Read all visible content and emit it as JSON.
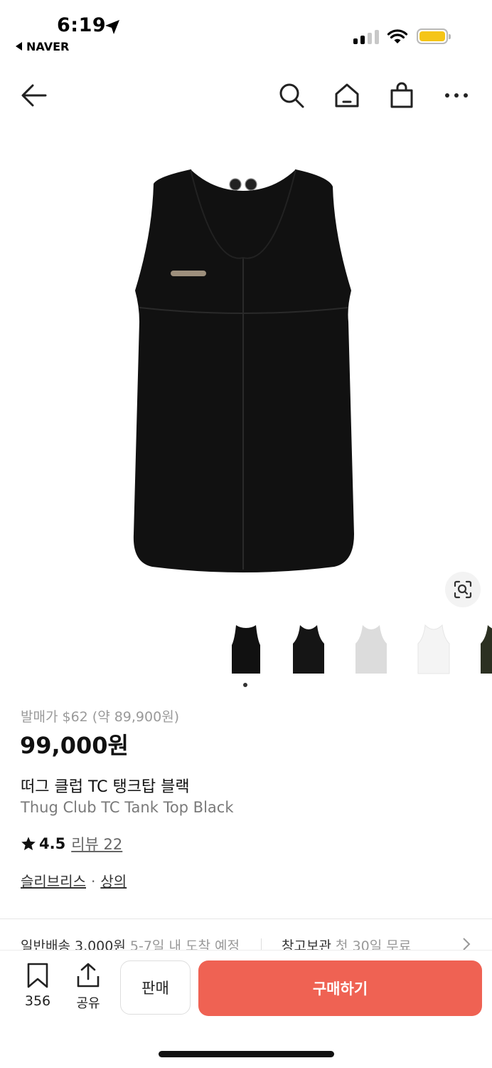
{
  "status_bar": {
    "time": "6:19",
    "back_app": "NAVER"
  },
  "product": {
    "original_price": "발매가 $62 (약 89,900원)",
    "price": "99,000원",
    "title_ko": "떠그 클럽 TC 탱크탑 블랙",
    "title_en": "Thug Club TC Tank Top Black",
    "rating": "4.5",
    "review_label": "리뷰 22",
    "brand": "슬리브리스",
    "category_sep": "·",
    "category": "상의"
  },
  "shipping": {
    "standard": "일반배송 3,000원",
    "standard_eta": "5-7일 내 도착 예정",
    "storage": "창고보관",
    "storage_note": "첫 30일 무료"
  },
  "bottom_bar": {
    "bookmark_count": "356",
    "share_label": "공유",
    "sell_label": "판매",
    "buy_label": "구매하기"
  },
  "colors": {
    "accent": "#ef6253",
    "battery": "#f5c518"
  },
  "thumbnails": [
    "black-tank-1",
    "black-tank-2",
    "gray-tank",
    "white-tank",
    "olive-tank"
  ]
}
